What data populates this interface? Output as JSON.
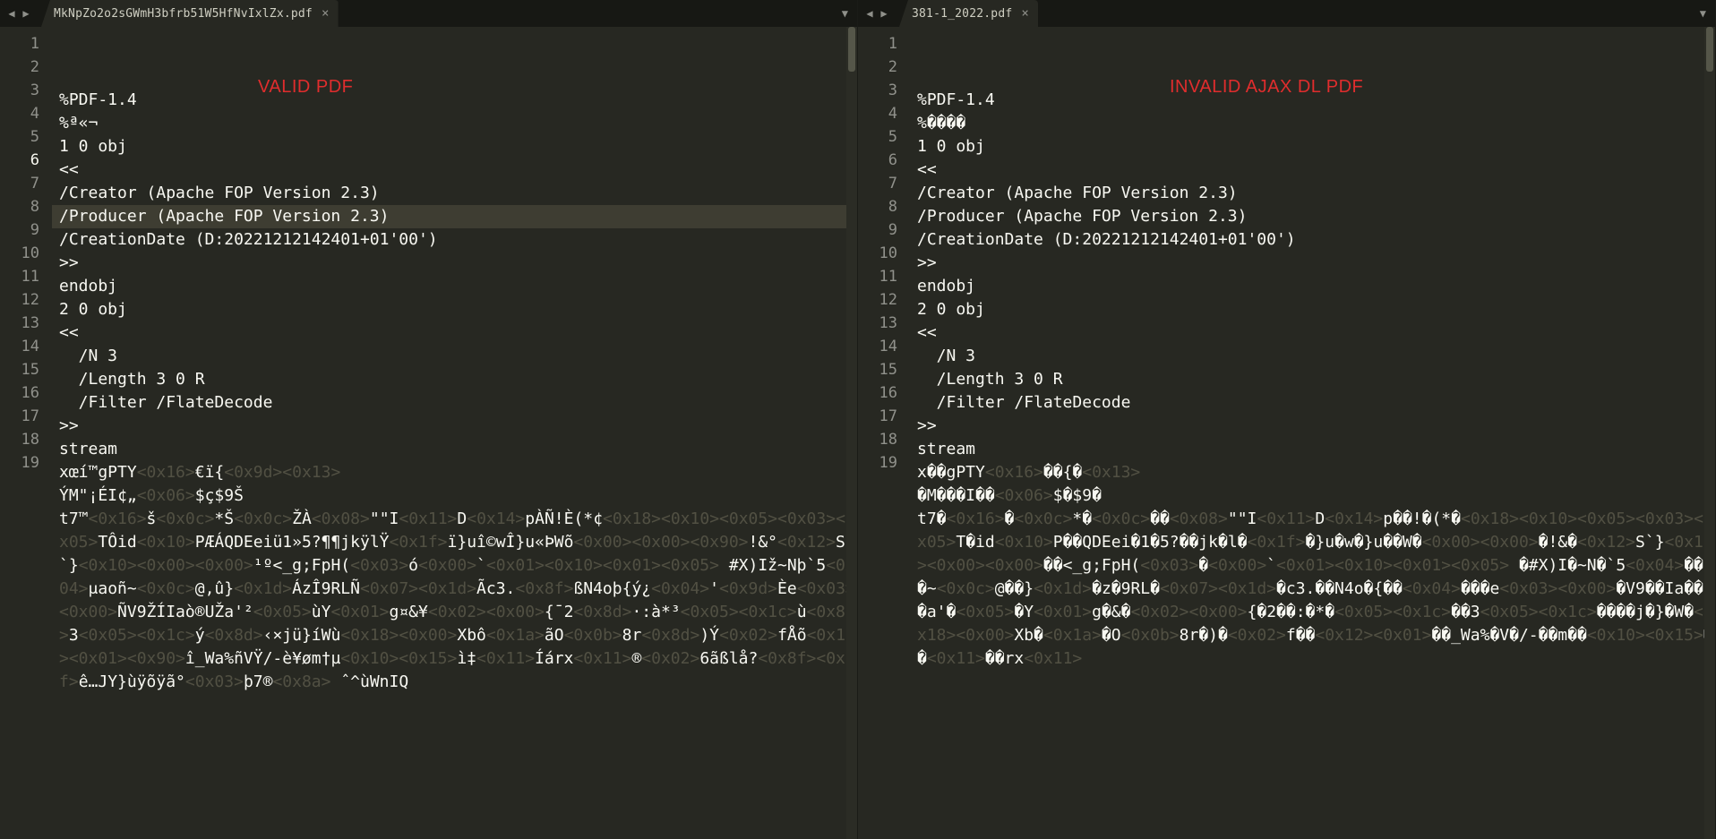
{
  "left": {
    "tab": {
      "title": "MkNpZo2o2sGWmH3bfrb51W5HfNvIxlZx.pdf",
      "close": "×",
      "nav_prev": "◀",
      "nav_next": "▶",
      "dropdown": "▼"
    },
    "overlay": "VALID PDF",
    "highlight_line": 6,
    "lines": [
      "%PDF-1.4",
      "%ª«¬",
      "1 0 obj",
      "<<",
      "/Creator (Apache FOP Version 2.3)",
      "/Producer (Apache FOP Version 2.3)",
      "/CreationDate (D:20221212142401+01'00')",
      ">>",
      "endobj",
      "2 0 obj",
      "<<",
      "  /N 3",
      "  /Length 3 0 R",
      "  /Filter /FlateDecode",
      ">>",
      "stream"
    ],
    "l17": [
      {
        "t": "txt",
        "v": "xœí™gPTY"
      },
      {
        "t": "hex",
        "v": "<0x16>"
      },
      {
        "t": "txt",
        "v": "€ï{"
      },
      {
        "t": "hex",
        "v": "<0x9d><0x13>"
      }
    ],
    "l18": [
      {
        "t": "txt",
        "v": "ÝM\"¡ÉI¢„"
      },
      {
        "t": "hex",
        "v": "<0x06>"
      },
      {
        "t": "txt",
        "v": "$ç$9Š"
      }
    ],
    "l19": [
      {
        "t": "txt",
        "v": "t7™"
      },
      {
        "t": "hex",
        "v": "<0x16>"
      },
      {
        "t": "txt",
        "v": "š"
      },
      {
        "t": "hex",
        "v": "<0x0c>"
      },
      {
        "t": "txt",
        "v": "*Š"
      },
      {
        "t": "hex",
        "v": "<0x0c>"
      },
      {
        "t": "txt",
        "v": "ŽÀ"
      },
      {
        "t": "hex",
        "v": "<0x08>"
      },
      {
        "t": "txt",
        "v": "\"\"I"
      },
      {
        "t": "hex",
        "v": "<0x11>"
      },
      {
        "t": "txt",
        "v": "D"
      },
      {
        "t": "hex",
        "v": "<0x14>"
      },
      {
        "t": "txt",
        "v": "pÀÑ!È(*¢"
      },
      {
        "t": "hex",
        "v": "<0x18><0x10><0x05><0x03><0x05>"
      },
      {
        "t": "txt",
        "v": "TÔid"
      },
      {
        "t": "hex",
        "v": "<0x10>"
      },
      {
        "t": "txt",
        "v": "PÆÁQDEeiü1»5?¶¶jkÿlŸ"
      },
      {
        "t": "hex",
        "v": "<0x1f>"
      },
      {
        "t": "txt",
        "v": "ï}uî©wÎ}u«ÞWõ"
      },
      {
        "t": "hex",
        "v": "<0x00><0x00><0x90>"
      },
      {
        "t": "txt",
        "v": "!&°"
      },
      {
        "t": "hex",
        "v": "<0x12>"
      },
      {
        "t": "txt",
        "v": "S`}"
      },
      {
        "t": "hex",
        "v": "<0x10><0x00><0x00>"
      },
      {
        "t": "txt",
        "v": "¹º<_g;FpH("
      },
      {
        "t": "hex",
        "v": "<0x03>"
      },
      {
        "t": "txt",
        "v": "ó"
      },
      {
        "t": "hex",
        "v": "<0x00>"
      },
      {
        "t": "txt",
        "v": "`"
      },
      {
        "t": "hex",
        "v": "<0x01><0x10><0x01><0x05>"
      },
      {
        "t": "txt",
        "v": " #X)Iž~Nþ`5"
      },
      {
        "t": "hex",
        "v": "<0x04>"
      },
      {
        "t": "txt",
        "v": "μaoñ~"
      },
      {
        "t": "hex",
        "v": "<0x0c>"
      },
      {
        "t": "txt",
        "v": "@‚û}"
      },
      {
        "t": "hex",
        "v": "<0x1d>"
      },
      {
        "t": "txt",
        "v": "ÁzÎ9RLÑ"
      },
      {
        "t": "hex",
        "v": "<0x07><0x1d>"
      },
      {
        "t": "txt",
        "v": "Ãc3."
      },
      {
        "t": "hex",
        "v": "<0x8f>"
      },
      {
        "t": "txt",
        "v": "ßN4oþ{ý¿"
      },
      {
        "t": "hex",
        "v": "<0x04>"
      },
      {
        "t": "txt",
        "v": "'"
      },
      {
        "t": "hex",
        "v": "<0x9d>"
      },
      {
        "t": "txt",
        "v": "Èe"
      },
      {
        "t": "hex",
        "v": "<0x03><0x00>"
      },
      {
        "t": "txt",
        "v": "ÑV9ŽÍIaò®UŽa'²"
      },
      {
        "t": "hex",
        "v": "<0x05>"
      },
      {
        "t": "txt",
        "v": "ùY"
      },
      {
        "t": "hex",
        "v": "<0x01>"
      },
      {
        "t": "txt",
        "v": "g¤&¥"
      },
      {
        "t": "hex",
        "v": "<0x02><0x00>"
      },
      {
        "t": "txt",
        "v": "{¯2"
      },
      {
        "t": "hex",
        "v": "<0x8d>"
      },
      {
        "t": "txt",
        "v": "·:à*³"
      },
      {
        "t": "hex",
        "v": "<0x05><0x1c>"
      },
      {
        "t": "txt",
        "v": "ù"
      },
      {
        "t": "hex",
        "v": "<0x8d>"
      },
      {
        "t": "txt",
        "v": "3"
      },
      {
        "t": "hex",
        "v": "<0x05><0x1c>"
      },
      {
        "t": "txt",
        "v": "ý"
      },
      {
        "t": "hex",
        "v": "<0x8d>"
      },
      {
        "t": "txt",
        "v": "‹×jü}íWù"
      },
      {
        "t": "hex",
        "v": "<0x18><0x00>"
      },
      {
        "t": "txt",
        "v": "Xbô"
      },
      {
        "t": "hex",
        "v": "<0x1a>"
      },
      {
        "t": "txt",
        "v": "ãO"
      },
      {
        "t": "hex",
        "v": "<0x0b>"
      },
      {
        "t": "txt",
        "v": "8r"
      },
      {
        "t": "hex",
        "v": "<0x8d>"
      },
      {
        "t": "txt",
        "v": ")Ý"
      },
      {
        "t": "hex",
        "v": "<0x02>"
      },
      {
        "t": "txt",
        "v": "fÅõ"
      },
      {
        "t": "hex",
        "v": "<0x12><0x01><0x90>"
      },
      {
        "t": "txt",
        "v": "î_Wa%ñVŸ/-è¥øm†µ"
      },
      {
        "t": "hex",
        "v": "<0x10><0x15>"
      },
      {
        "t": "txt",
        "v": "ì‡"
      },
      {
        "t": "hex",
        "v": "<0x11>"
      },
      {
        "t": "txt",
        "v": "Íárx"
      },
      {
        "t": "hex",
        "v": "<0x11>"
      },
      {
        "t": "txt",
        "v": "®"
      },
      {
        "t": "hex",
        "v": "<0x02>"
      },
      {
        "t": "txt",
        "v": "6ãßlå?"
      },
      {
        "t": "hex",
        "v": "<0x8f><0x7f>"
      },
      {
        "t": "txt",
        "v": "ê…JY}ùÿõÿã°"
      },
      {
        "t": "hex",
        "v": "<0x03>"
      },
      {
        "t": "txt",
        "v": "þ7®"
      },
      {
        "t": "hex",
        "v": "<0x8a>"
      },
      {
        "t": "txt",
        "v": " ˆ^ùWnIQ"
      }
    ]
  },
  "right": {
    "tab": {
      "title": "381-1_2022.pdf",
      "close": "×",
      "nav_prev": "◀",
      "nav_next": "▶",
      "dropdown": "▼"
    },
    "overlay": "INVALID AJAX DL PDF",
    "highlight_line": null,
    "lines": [
      "%PDF-1.4",
      "%����",
      "1 0 obj",
      "<<",
      "/Creator (Apache FOP Version 2.3)",
      "/Producer (Apache FOP Version 2.3)",
      "/CreationDate (D:20221212142401+01'00')",
      ">>",
      "endobj",
      "2 0 obj",
      "<<",
      "  /N 3",
      "  /Length 3 0 R",
      "  /Filter /FlateDecode",
      ">>",
      "stream"
    ],
    "l17": [
      {
        "t": "txt",
        "v": "x��gPTY"
      },
      {
        "t": "hex",
        "v": "<0x16>"
      },
      {
        "t": "txt",
        "v": "��{�"
      },
      {
        "t": "hex",
        "v": "<0x13>"
      }
    ],
    "l18": [
      {
        "t": "txt",
        "v": "�M���I��"
      },
      {
        "t": "hex",
        "v": "<0x06>"
      },
      {
        "t": "txt",
        "v": "$�$9�"
      }
    ],
    "l19": [
      {
        "t": "txt",
        "v": "t7�"
      },
      {
        "t": "hex",
        "v": "<0x16>"
      },
      {
        "t": "txt",
        "v": "�"
      },
      {
        "t": "hex",
        "v": "<0x0c>"
      },
      {
        "t": "txt",
        "v": "*�"
      },
      {
        "t": "hex",
        "v": "<0x0c>"
      },
      {
        "t": "txt",
        "v": "��"
      },
      {
        "t": "hex",
        "v": "<0x08>"
      },
      {
        "t": "txt",
        "v": "\"\"I"
      },
      {
        "t": "hex",
        "v": "<0x11>"
      },
      {
        "t": "txt",
        "v": "D"
      },
      {
        "t": "hex",
        "v": "<0x14>"
      },
      {
        "t": "txt",
        "v": "p��!�(*�"
      },
      {
        "t": "hex",
        "v": "<0x18><0x10><0x05><0x03><0x05>"
      },
      {
        "t": "txt",
        "v": "T�id"
      },
      {
        "t": "hex",
        "v": "<0x10>"
      },
      {
        "t": "txt",
        "v": "P��QDEei�1�5?��jk�l�"
      },
      {
        "t": "hex",
        "v": "<0x1f>"
      },
      {
        "t": "txt",
        "v": "�}u�w�}u��W�"
      },
      {
        "t": "hex",
        "v": "<0x00><0x00>"
      },
      {
        "t": "txt",
        "v": "�!&�"
      },
      {
        "t": "hex",
        "v": "<0x12>"
      },
      {
        "t": "txt",
        "v": "S`}"
      },
      {
        "t": "hex",
        "v": "<0x10><0x00><0x00>"
      },
      {
        "t": "txt",
        "v": "��<_g;FpH("
      },
      {
        "t": "hex",
        "v": "<0x03>"
      },
      {
        "t": "txt",
        "v": "�"
      },
      {
        "t": "hex",
        "v": "<0x00>"
      },
      {
        "t": "txt",
        "v": "`"
      },
      {
        "t": "hex",
        "v": "<0x01><0x10><0x01><0x05>"
      },
      {
        "t": "txt",
        "v": " �#X)I�~N�`5"
      },
      {
        "t": "hex",
        "v": "<0x04>"
      },
      {
        "t": "txt",
        "v": "��o�~"
      },
      {
        "t": "hex",
        "v": "<0x0c>"
      },
      {
        "t": "txt",
        "v": "@��}"
      },
      {
        "t": "hex",
        "v": "<0x1d>"
      },
      {
        "t": "txt",
        "v": "�z�9RL�"
      },
      {
        "t": "hex",
        "v": "<0x07><0x1d>"
      },
      {
        "t": "txt",
        "v": "�c3.��N4o�{��"
      },
      {
        "t": "hex",
        "v": "<0x04>"
      },
      {
        "t": "txt",
        "v": "���e"
      },
      {
        "t": "hex",
        "v": "<0x03><0x00>"
      },
      {
        "t": "txt",
        "v": "�V9��Ia��U�a'�"
      },
      {
        "t": "hex",
        "v": "<0x05>"
      },
      {
        "t": "txt",
        "v": "�Y"
      },
      {
        "t": "hex",
        "v": "<0x01>"
      },
      {
        "t": "txt",
        "v": "g�&�"
      },
      {
        "t": "hex",
        "v": "<0x02><0x00>"
      },
      {
        "t": "txt",
        "v": "{�2��:�*�"
      },
      {
        "t": "hex",
        "v": "<0x05><0x1c>"
      },
      {
        "t": "txt",
        "v": "��3"
      },
      {
        "t": "hex",
        "v": "<0x05><0x1c>"
      },
      {
        "t": "txt",
        "v": "����j�}�W�"
      },
      {
        "t": "hex",
        "v": "<0x18><0x00>"
      },
      {
        "t": "txt",
        "v": "Xb�"
      },
      {
        "t": "hex",
        "v": "<0x1a>"
      },
      {
        "t": "txt",
        "v": "�O"
      },
      {
        "t": "hex",
        "v": "<0x0b>"
      },
      {
        "t": "txt",
        "v": "8r�)�"
      },
      {
        "t": "hex",
        "v": "<0x02>"
      },
      {
        "t": "txt",
        "v": "f��"
      },
      {
        "t": "hex",
        "v": "<0x12><0x01>"
      },
      {
        "t": "txt",
        "v": "��_Wa%�V�/-��m��"
      },
      {
        "t": "hex",
        "v": "<0x10><0x15>"
      },
      {
        "t": "txt",
        "v": "��"
      },
      {
        "t": "hex",
        "v": "<0x11>"
      },
      {
        "t": "txt",
        "v": "��rx"
      },
      {
        "t": "hex",
        "v": "<0x11>"
      }
    ]
  }
}
